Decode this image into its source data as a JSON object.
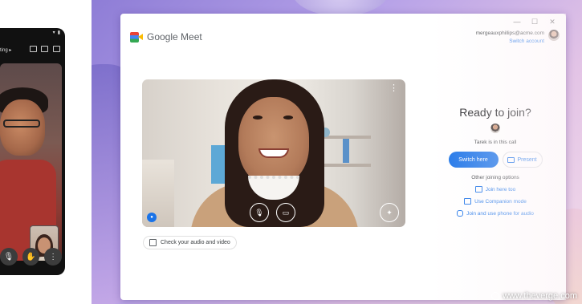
{
  "phone": {
    "status_label": "ting",
    "status_chevron": "▸",
    "controls": [
      {
        "icon": "mic-icon",
        "glyph": "🎙"
      },
      {
        "icon": "hand-icon",
        "glyph": "✋"
      },
      {
        "icon": "more-vert-icon",
        "glyph": "⋮"
      }
    ]
  },
  "window": {
    "minimize": "—",
    "maximize": "☐",
    "close": "✕"
  },
  "app": {
    "title": "Google Meet"
  },
  "account": {
    "email": "mergeauxphillips@acme.com",
    "switch_label": "Switch account"
  },
  "preview": {
    "more_glyph": "⋮",
    "mic_glyph": "🎙",
    "cam_glyph": "▭",
    "fx_glyph": "✦",
    "check_label": "Check your audio and video"
  },
  "join": {
    "heading": "Ready to join?",
    "in_call_text": "Tarek is in this call",
    "switch_here_label": "Switch here",
    "present_label": "Present",
    "other_options_label": "Other joining options",
    "options": [
      {
        "icon": "cast-icon",
        "label": "Join here too"
      },
      {
        "icon": "companion-icon",
        "label": "Use Companion mode"
      },
      {
        "icon": "phone-icon",
        "label": "Join and use phone for audio"
      }
    ]
  },
  "watermark": {
    "text": "www.theverge.com"
  },
  "colors": {
    "primary": "#1a73e8",
    "desktop_bg": "#b4a0e8"
  }
}
